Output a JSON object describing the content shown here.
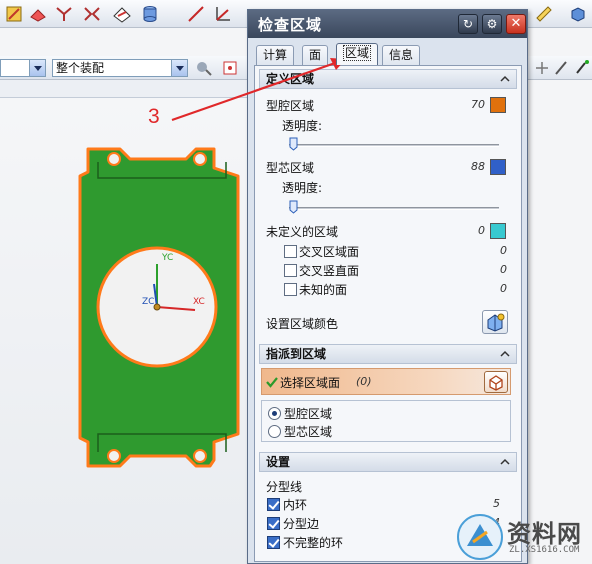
{
  "assembly_combo": {
    "value": "整个装配"
  },
  "annotation": {
    "number": "3"
  },
  "part_axes": {
    "y_label": "YC",
    "z_label": "ZC",
    "x_label": "XC"
  },
  "dialog": {
    "title": "检查区域",
    "tabs": [
      {
        "label": "计算"
      },
      {
        "label": "面"
      },
      {
        "label": "区域",
        "active": true
      },
      {
        "label": "信息"
      }
    ],
    "define_region": {
      "header": "定义区域",
      "cavity": {
        "label": "型腔区域",
        "count": "70",
        "color": "#e0710d"
      },
      "cavity_transparency_label": "透明度:",
      "cavity_transparency": 0,
      "core": {
        "label": "型芯区域",
        "count": "88",
        "color": "#3060c8"
      },
      "core_transparency_label": "透明度:",
      "core_transparency": 0,
      "undefined": {
        "label": "未定义的区域",
        "count": "0",
        "color": "#38c9d0"
      },
      "sub_items": [
        {
          "label": "交叉区域面",
          "count": "0",
          "checked": false
        },
        {
          "label": "交叉竖直面",
          "count": "0",
          "checked": false
        },
        {
          "label": "未知的面",
          "count": "0",
          "checked": false
        }
      ],
      "set_color_label": "设置区域颜色"
    },
    "assign_region": {
      "header": "指派到区域",
      "select_label": "选择区域面",
      "select_count": "(0)",
      "options": [
        {
          "label": "型腔区域",
          "selected": true
        },
        {
          "label": "型芯区域",
          "selected": false
        }
      ]
    },
    "settings": {
      "header": "设置",
      "parting_line_label": "分型线",
      "items": [
        {
          "label": "内环",
          "count": "5",
          "checked": true
        },
        {
          "label": "分型边",
          "count": "24",
          "checked": true
        },
        {
          "label": "不完整的环",
          "count": "",
          "checked": true
        }
      ]
    }
  },
  "watermark": {
    "text": "资料网",
    "url": "ZL.XS1616.COM"
  }
}
